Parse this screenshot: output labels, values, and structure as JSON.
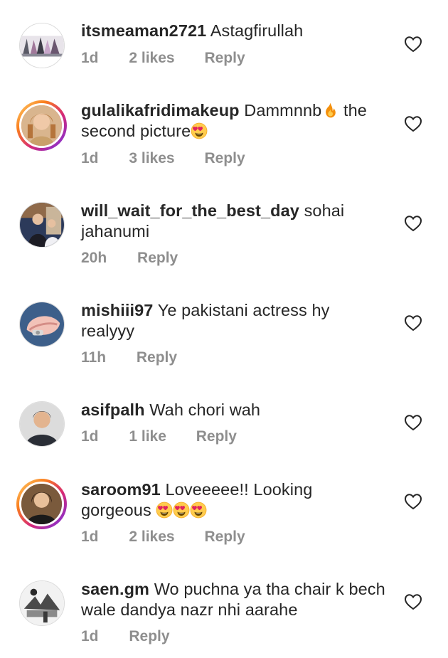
{
  "comments": [
    {
      "username": "itsmeaman2721",
      "text": "Astagfirullah",
      "time": "1d",
      "likes": "2 likes",
      "reply": "Reply"
    },
    {
      "username": "gulalikafridimakeup",
      "text_a": "Dammnnb",
      "text_b": " the",
      "text_c": "second picture",
      "time": "1d",
      "likes": "3 likes",
      "reply": "Reply"
    },
    {
      "username": "will_wait_for_the_best_day",
      "text_a": "sohai",
      "text_b": "jahanumi",
      "time": "20h",
      "reply": "Reply"
    },
    {
      "username": "mishiii97",
      "text_a": "Ye pakistani actress hy",
      "text_b": "realyyy",
      "time": "11h",
      "reply": "Reply"
    },
    {
      "username": "asifpalh",
      "text": "Wah chori wah",
      "time": "1d",
      "likes": "1 like",
      "reply": "Reply"
    },
    {
      "username": "saroom91",
      "text_a": "Loveeeee!! Looking",
      "text_b": "gorgeous",
      "time": "1d",
      "likes": "2 likes",
      "reply": "Reply"
    },
    {
      "username": "saen.gm",
      "text_a": "Wo puchna ya tha chair k bech",
      "text_b": "wale dandya nazr nhi aarahe",
      "time": "1d",
      "reply": "Reply"
    }
  ],
  "icons": {
    "like": "heart-outline-icon",
    "fire": "fire-emoji",
    "heart_eyes": "heart-eyes-emoji"
  },
  "colors": {
    "text": "#262626",
    "muted": "#8e8e8e",
    "story_ring_start": "#feda75",
    "story_ring_end": "#962fbf"
  }
}
